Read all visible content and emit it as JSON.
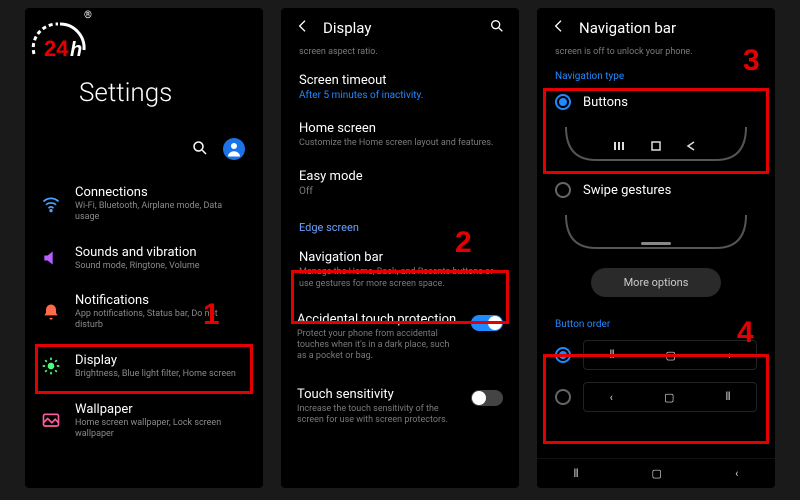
{
  "logo": {
    "text": "24h",
    "registered": "®"
  },
  "annotations": {
    "n1": "1",
    "n2": "2",
    "n3": "3",
    "n4": "4"
  },
  "panel1": {
    "title": "Settings",
    "items": [
      {
        "title": "Connections",
        "sub": "Wi-Fi, Bluetooth, Airplane mode, Data usage",
        "icon": "wifi"
      },
      {
        "title": "Sounds and vibration",
        "sub": "Sound mode, Ringtone, Volume",
        "icon": "sound"
      },
      {
        "title": "Notifications",
        "sub": "App notifications, Status bar, Do not disturb",
        "icon": "bell"
      },
      {
        "title": "Display",
        "sub": "Brightness, Blue light filter, Home screen",
        "icon": "sun"
      },
      {
        "title": "Wallpaper",
        "sub": "Home screen wallpaper, Lock screen wallpaper",
        "icon": "image"
      }
    ]
  },
  "panel2": {
    "header": "Display",
    "topHint": "screen aspect ratio.",
    "rows": {
      "timeout": {
        "title": "Screen timeout",
        "value": "After 5 minutes of inactivity."
      },
      "home": {
        "title": "Home screen",
        "sub": "Customize the Home screen layout and features."
      },
      "easy": {
        "title": "Easy mode",
        "value": "Off"
      }
    },
    "edgeSection": "Edge screen",
    "navbar": {
      "title": "Navigation bar",
      "sub": "Manage the Home, Back, and Recents buttons or use gestures for more screen space."
    },
    "accidental": {
      "title": "Accidental touch protection",
      "sub": "Protect your phone from accidental touches when it's in a dark place, such as a pocket or bag."
    },
    "sensitivity": {
      "title": "Touch sensitivity",
      "sub": "Increase the touch sensitivity of the screen for use with screen protectors."
    }
  },
  "panel3": {
    "header": "Navigation bar",
    "topHint": "screen is off to unlock your phone.",
    "navTypeLabel": "Navigation type",
    "options": {
      "buttons": "Buttons",
      "swipe": "Swipe gestures"
    },
    "moreOptions": "More options",
    "buttonOrderLabel": "Button order"
  }
}
